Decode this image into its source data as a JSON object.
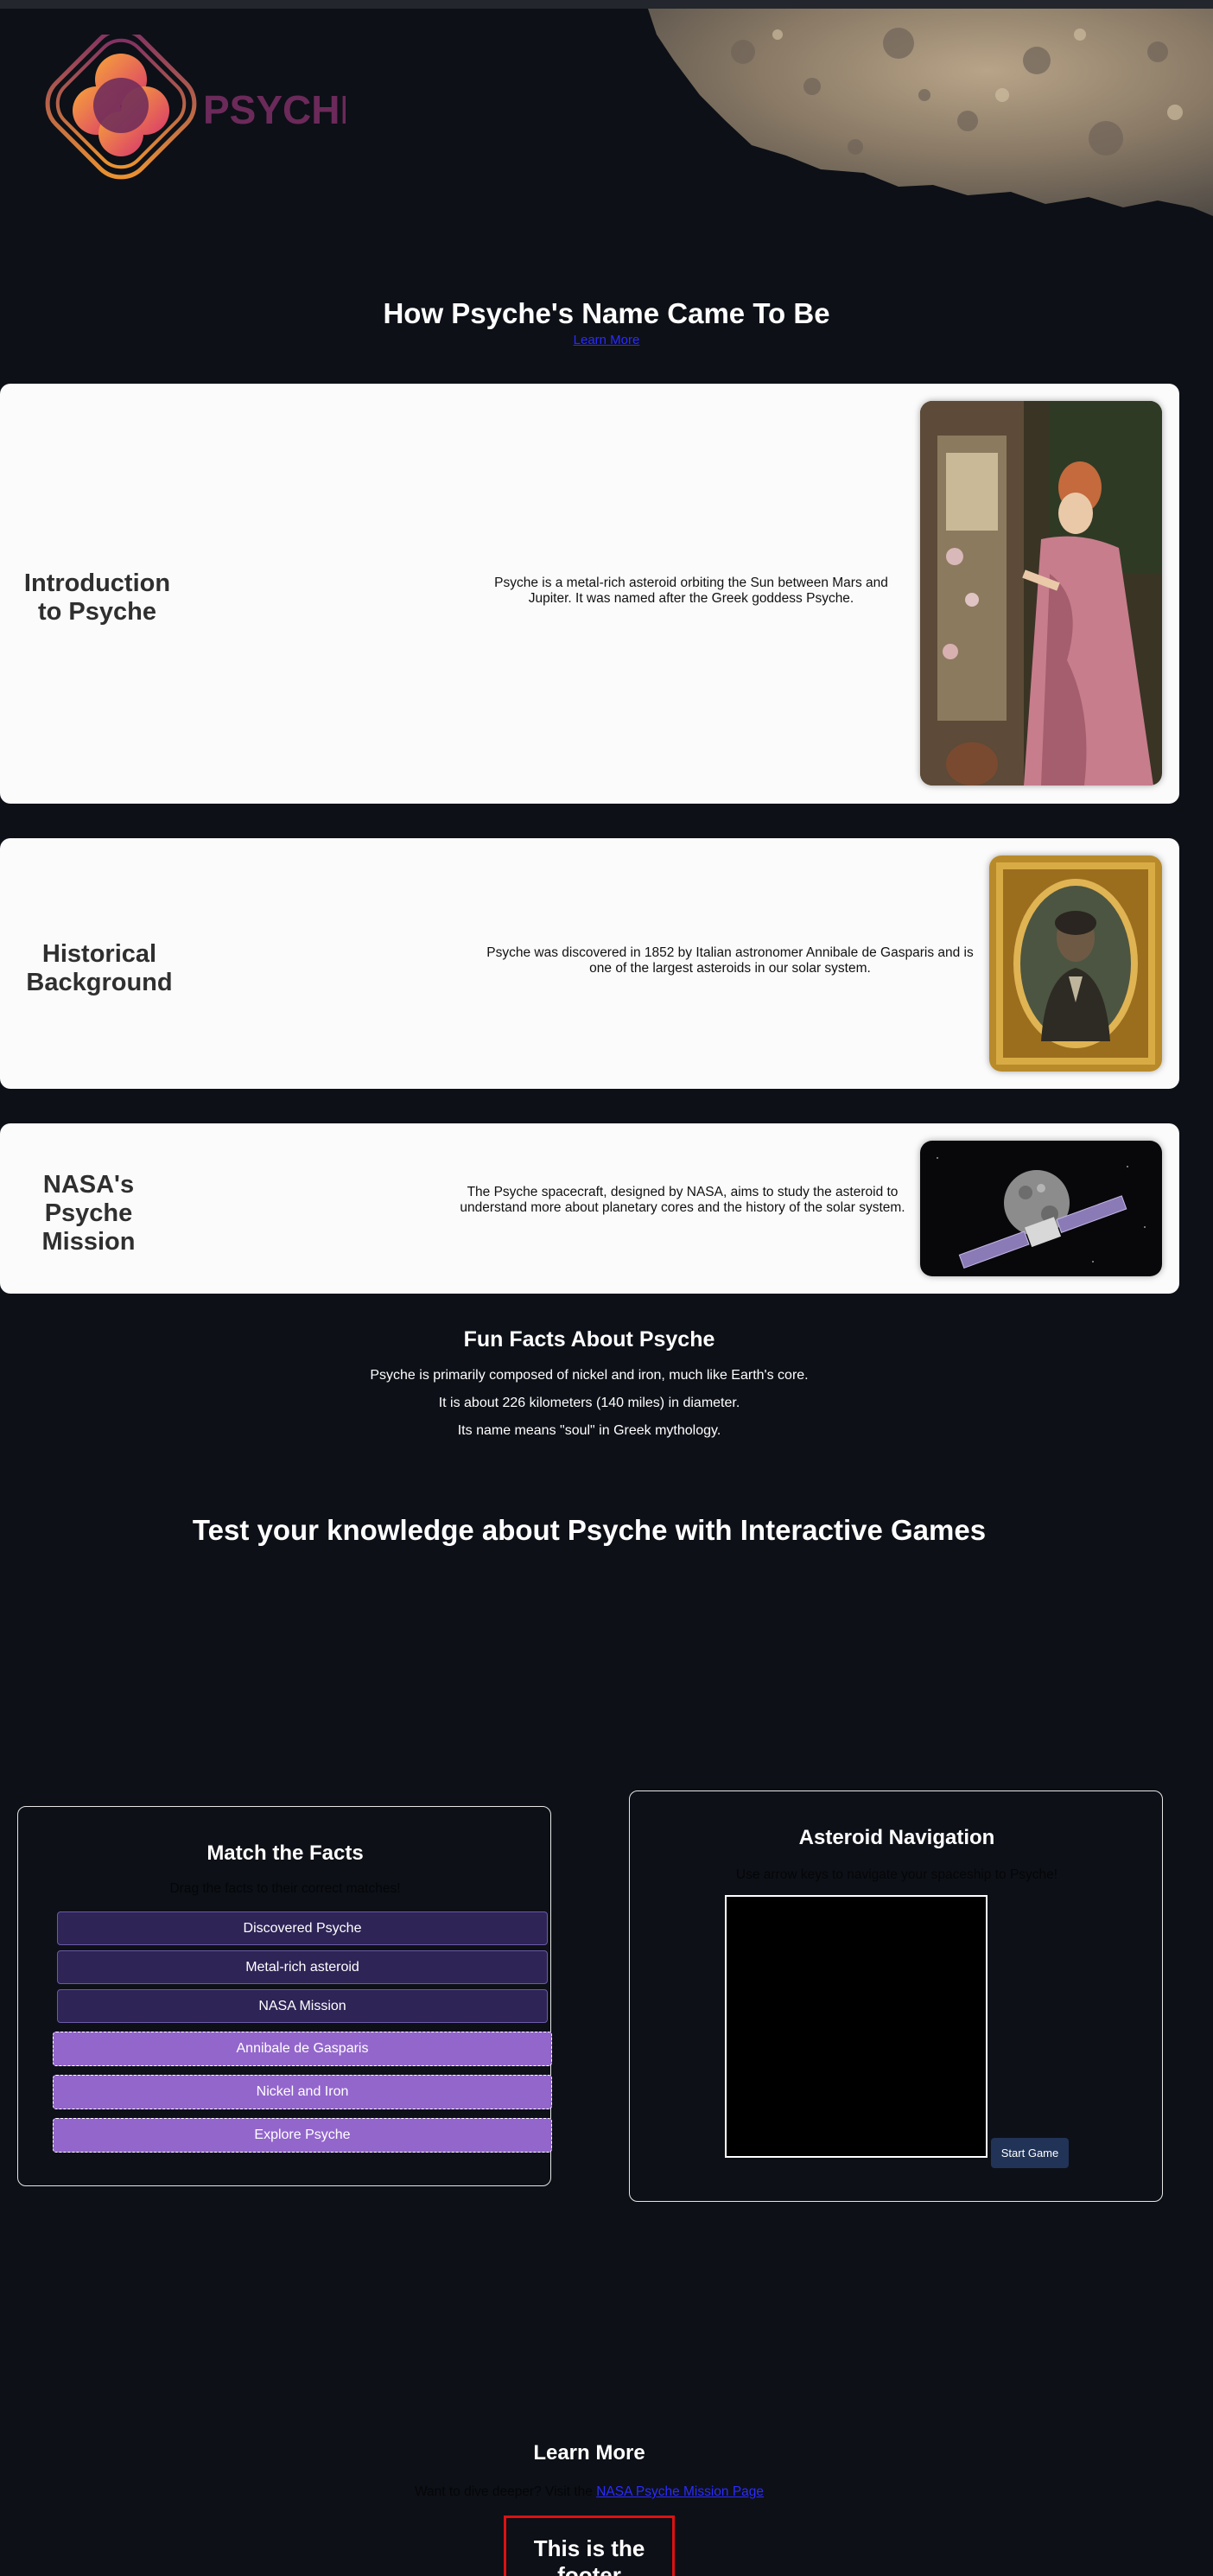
{
  "brand": {
    "name": "PSYCHE",
    "colors": {
      "purple": "#6b2a5a",
      "orange": "#f39a2c",
      "pink": "#d94a73"
    }
  },
  "hero": {
    "title": "How Psyche's Name Came To Be",
    "link": "Learn More"
  },
  "cards": [
    {
      "heading": "Introduction to Psyche",
      "text": "Psyche is a metal-rich asteroid orbiting the Sun between Mars and Jupiter. It was named after the Greek goddess Psyche.",
      "image_icon": "painting-psyche-goddess-icon"
    },
    {
      "heading": "Historical Background",
      "text": "Psyche was discovered in 1852 by Italian astronomer Annibale de Gasparis and is one of the largest asteroids in our solar system.",
      "image_icon": "portrait-annibale-de-gasparis-icon"
    },
    {
      "heading": "NASA's Psyche Mission",
      "text": "The Psyche spacecraft, designed by NASA, aims to study the asteroid to understand more about planetary cores and the history of the solar system.",
      "image_icon": "spacecraft-asteroid-icon"
    }
  ],
  "facts": {
    "title": "Fun Facts About Psyche",
    "items": [
      "Psyche is primarily composed of nickel and iron, much like Earth's core.",
      "It is about 226 kilometers (140 miles) in diameter.",
      "Its name means \"soul\" in Greek mythology."
    ]
  },
  "games": {
    "title": "Test your knowledge about Psyche with Interactive Games",
    "match": {
      "title": "Match the Facts",
      "instructions": "Drag the facts to their correct matches!",
      "prompts": [
        "Discovered Psyche",
        "Metal-rich asteroid",
        "NASA Mission"
      ],
      "answers": [
        "Annibale de Gasparis",
        "Nickel and Iron",
        "Explore Psyche"
      ]
    },
    "navigation": {
      "title": "Asteroid Navigation",
      "instructions": "Use arrow keys to navigate your spaceship to Psyche!",
      "start_label": "Start Game"
    }
  },
  "learn_more": {
    "title": "Learn More",
    "prefix": "Want to dive deeper? Visit the",
    "link": "NASA Psyche Mission Page"
  },
  "footer": {
    "text": "This is the footer"
  }
}
